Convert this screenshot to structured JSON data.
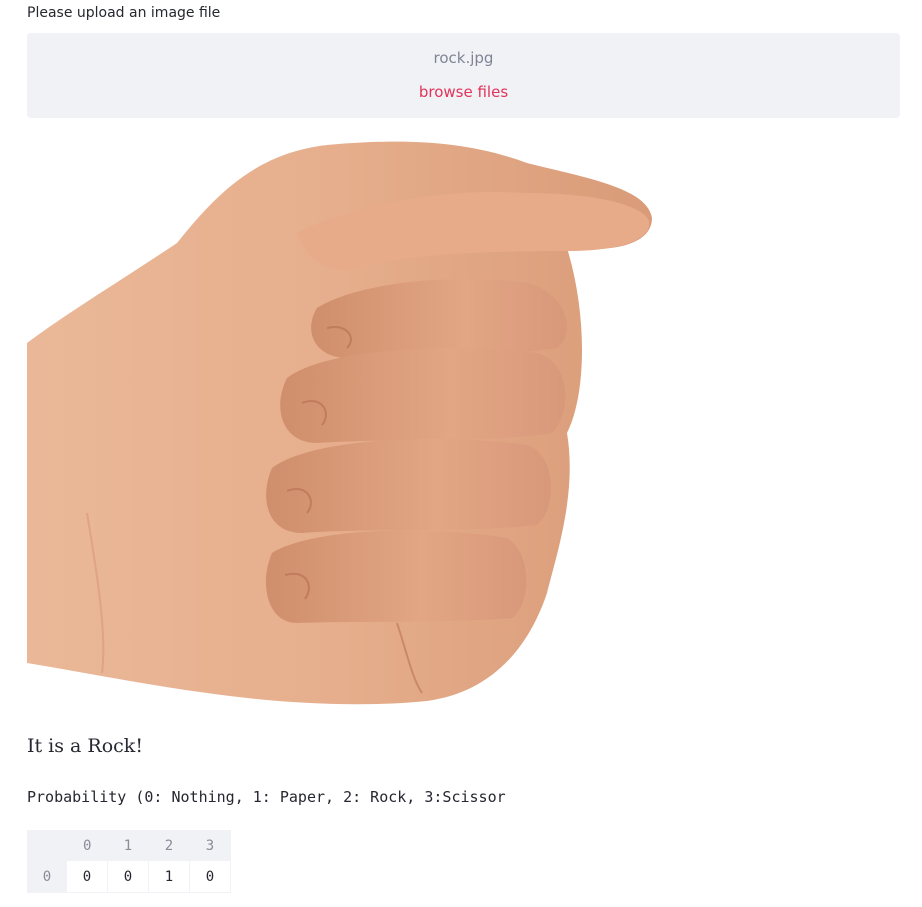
{
  "uploader": {
    "label": "Please upload an image file",
    "file_name": "rock.jpg",
    "browse_label": "browse files"
  },
  "image": {
    "description_icon": "fist-photo"
  },
  "result": {
    "text": "It is a Rock!",
    "probability_caption": "Probability (0: Nothing, 1: Paper, 2: Rock, 3:Scissor"
  },
  "table": {
    "columns": [
      "0",
      "1",
      "2",
      "3"
    ],
    "rows": [
      {
        "index": "0",
        "values": [
          "0",
          "0",
          "1",
          "0"
        ]
      }
    ]
  },
  "colors": {
    "accent": "#e0345b",
    "panel": "#f0f2f6",
    "text": "#262730"
  }
}
